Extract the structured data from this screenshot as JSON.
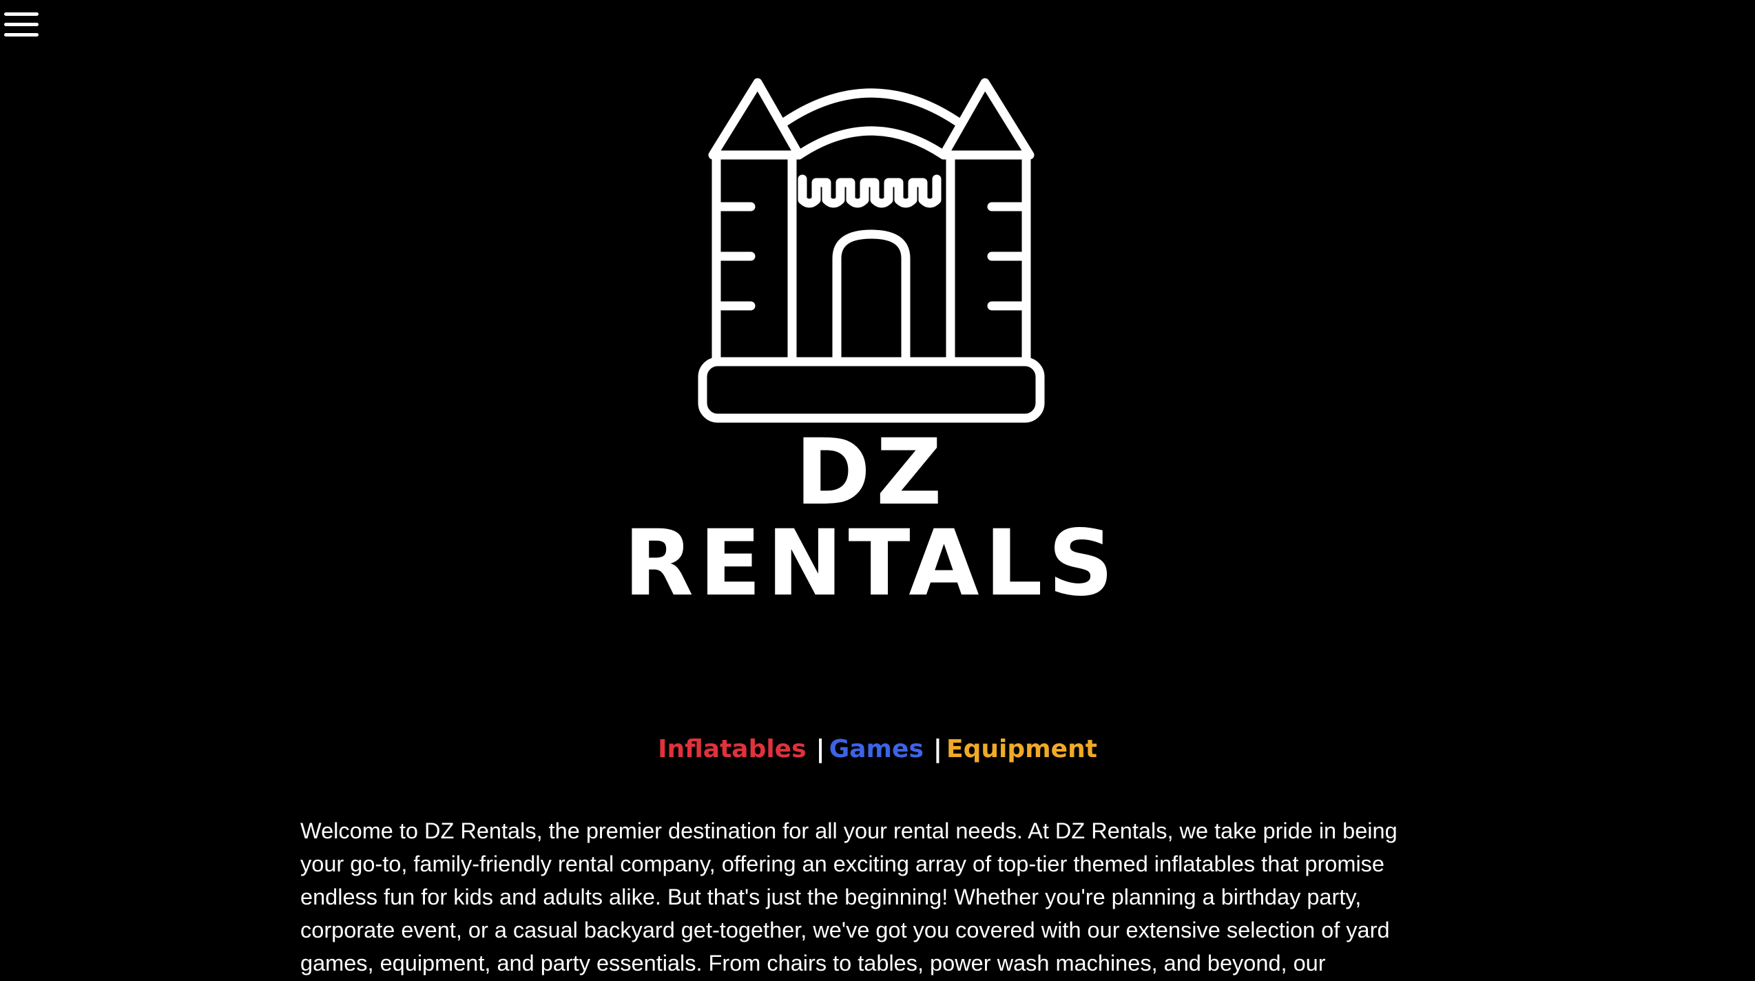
{
  "header": {
    "menu_icon": "hamburger-menu-icon"
  },
  "logo": {
    "icon": "bounce-castle-icon",
    "text": "DZ RENTALS"
  },
  "nav": {
    "items": [
      {
        "label": "Inflatables",
        "color": "#e0323c"
      },
      {
        "label": "Games",
        "color": "#3c64e6"
      },
      {
        "label": "Equipment",
        "color": "#f0aa28"
      }
    ],
    "separator": "|"
  },
  "intro": {
    "text": "Welcome to DZ Rentals, the premier destination for all your rental needs. At DZ Rentals, we take pride in being your go-to, family-friendly rental company, offering an exciting array of top-tier themed inflatables that promise endless fun for kids and adults alike. But that's just the beginning! Whether you're planning a birthday party, corporate event, or a casual backyard get-together, we've got you covered with our extensive selection of yard games, equipment, and party essentials. From chairs to tables, power wash machines, and beyond, our"
  },
  "colors": {
    "background": "#000000",
    "text": "#ffffff"
  }
}
